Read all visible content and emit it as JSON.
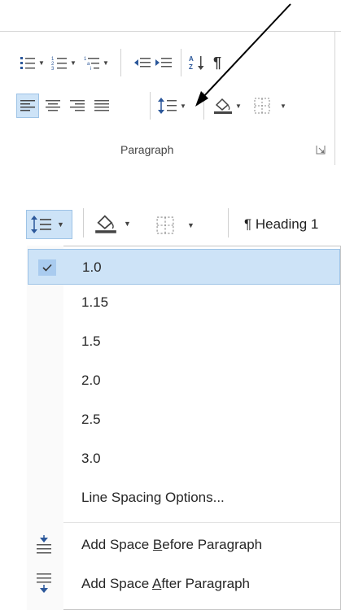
{
  "ribbon": {
    "group_label": "Paragraph",
    "icons": [
      "bullets-icon",
      "numbering-icon",
      "multilevel-list-icon",
      "decrease-indent-icon",
      "increase-indent-icon",
      "sort-icon",
      "show-formatting-marks-icon",
      "align-left-icon",
      "center-icon",
      "align-right-icon",
      "justify-icon",
      "line-spacing-icon",
      "shading-icon",
      "borders-icon",
      "dialog-launcher-icon"
    ]
  },
  "toolbar2": {
    "style_preview": "¶ Heading 1"
  },
  "menu": {
    "items": [
      {
        "label": "1.0",
        "checked": true
      },
      {
        "label": "1.15"
      },
      {
        "label": "1.5"
      },
      {
        "label": "2.0"
      },
      {
        "label": "2.5"
      },
      {
        "label": "3.0"
      },
      {
        "label": "Line Spacing Options..."
      }
    ],
    "space_before": {
      "pre": "Add Space ",
      "key": "B",
      "post": "efore Paragraph"
    },
    "space_after": {
      "pre": "Add Space ",
      "key": "A",
      "post": "fter Paragraph"
    }
  },
  "colors": {
    "accent": "#2b579a",
    "highlight": "#cde3f7",
    "highlight_border": "#9ec3e6"
  }
}
